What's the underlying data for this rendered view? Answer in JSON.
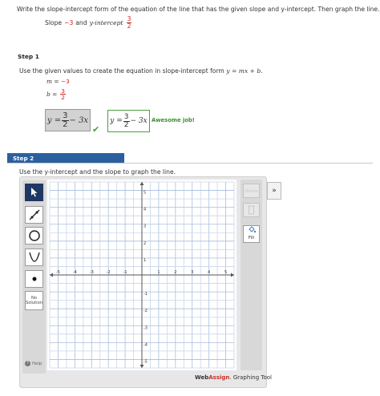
{
  "problem": {
    "text": "Write the slope-intercept form of the equation of the line that has the given slope and y-intercept. Then graph the line.",
    "slope_label": "Slope",
    "slope_value": "−3",
    "and_text": "and",
    "intercept_label": "y-intercept",
    "intercept_num": "3",
    "intercept_den": "2"
  },
  "step1": {
    "heading": "Step 1",
    "instruction": "Use the given values to create the equation in slope-intercept form",
    "formula": "y = mx + b.",
    "m_label": "m =",
    "m_value": "−3",
    "b_label": "b =",
    "b_num": "3",
    "b_den": "2",
    "entry_left": "y =",
    "entry_num": "3",
    "entry_den": "2",
    "entry_right": "− 3x",
    "check_icon": "checkmark-icon",
    "answer_left": "y =",
    "answer_num": "3",
    "answer_den": "2",
    "answer_right": "− 3x",
    "feedback": "Awesome job!"
  },
  "step2": {
    "heading": "Step 2",
    "instruction": "Use the y-intercept and the slope to graph the line."
  },
  "graph_tool": {
    "tools": [
      "pointer-icon",
      "line-icon",
      "circle-icon",
      "parabola-icon",
      "point-icon"
    ],
    "no_solution_label_1": "No",
    "no_solution_label_2": "Solution",
    "help_label": "Help",
    "delete_label": "Delete",
    "fill_label": "Fill",
    "expand_label": "»",
    "brand_1": "Web",
    "brand_2": "Assign",
    "brand_3": ". Graphing Tool",
    "grid": {
      "xmin": -5.5,
      "xmax": 5.5,
      "ymin": -5.5,
      "ymax": 5.5,
      "minor_step": 0.5
    },
    "x_ticks": [
      "-5",
      "-4",
      "-3",
      "-2",
      "-1",
      "1",
      "2",
      "3",
      "4",
      "5"
    ],
    "y_ticks": [
      "5",
      "4",
      "3",
      "2",
      "1",
      "-1",
      "-2",
      "-3",
      "-4",
      "-5"
    ]
  }
}
